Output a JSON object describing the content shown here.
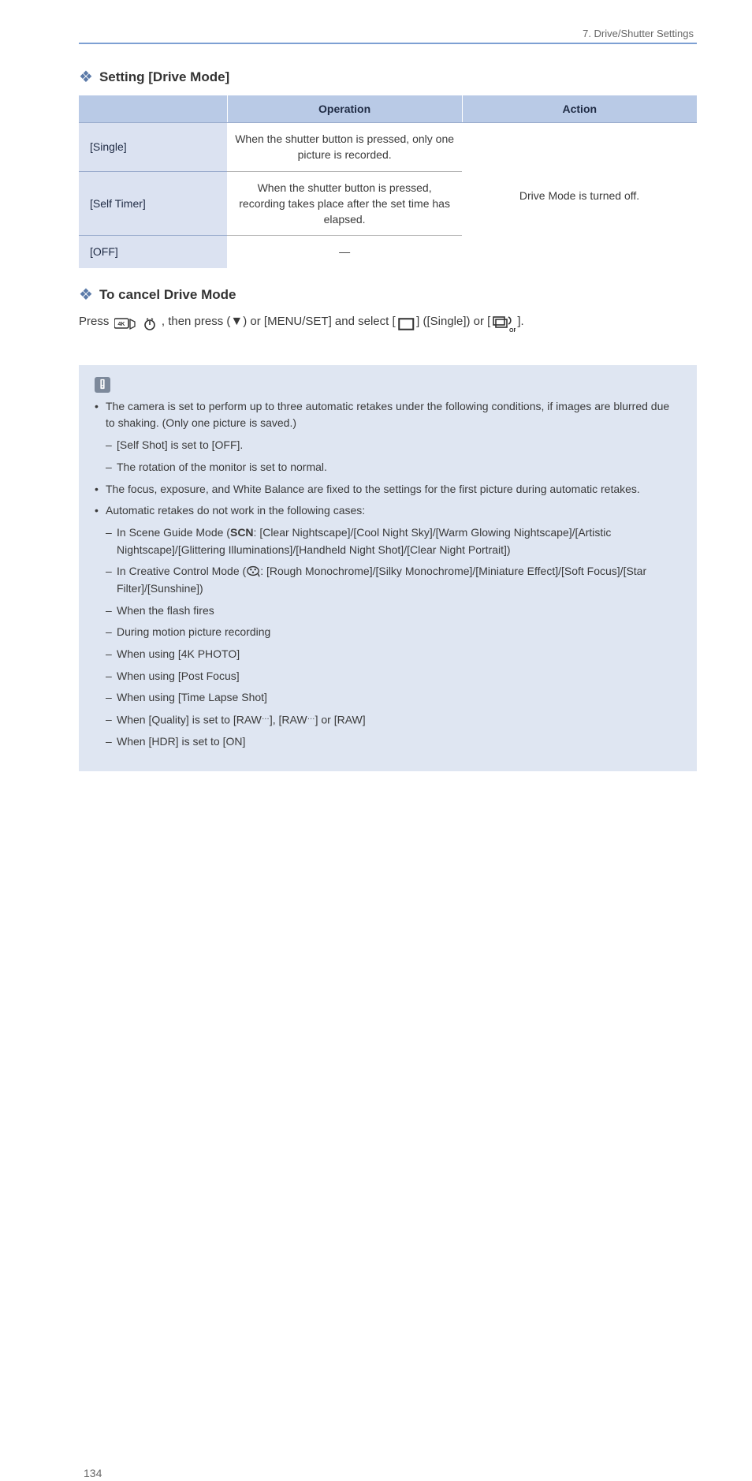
{
  "header": {
    "section_label": "7. Drive/Shutter Settings"
  },
  "sec_setting": {
    "title": "Setting [Drive Mode]",
    "table": {
      "headers": [
        "",
        "Operation",
        "Action"
      ],
      "rows": [
        {
          "label": "[Single]",
          "op": "When the shutter button is pressed, only one picture is recorded.",
          "action_rowspan": "Drive Mode is turned off."
        },
        {
          "label": "[Self Timer]",
          "op": "When the shutter button is pressed, recording takes place after the set time has elapsed."
        },
        {
          "label": "[OFF]",
          "op": "—"
        }
      ]
    }
  },
  "sec_cancel": {
    "title": "To cancel Drive Mode",
    "line_lead": "Press ",
    "line_mid": ", then press ",
    "line_tail1": " or [MENU/SET] and select [",
    "line_tail2": "] ([Single]) or [",
    "line_tail3": "].",
    "icons": {
      "k4": "4K-timer",
      "down": "▼",
      "square": "Single",
      "off": "Drive OFF"
    }
  },
  "notes": {
    "items": [
      "The camera is set to perform up to three automatic retakes under the following conditions, if images are blurred due to shaking. (Only one picture is saved.)",
      "sub:[Self Shot] is set to [OFF].",
      "sub:The rotation of the monitor is set to normal.",
      "The focus, exposure, and White Balance are fixed to the settings for the first picture during automatic retakes.",
      "Automatic retakes do not work in the following cases:",
      "sub:In Scene Guide Mode ([SCN]: [Clear Nightscape]/[Cool Night Sky]/[Warm Glowing Nightscape]/[Artistic Nightscape]/[Glittering Illuminations]/[Handheld Night Shot]/[Clear Night Portrait])",
      "sub:In Creative Control Mode ([creative-control-icon]: [Rough Monochrome]/[Silky Monochrome]/[Miniature Effect]/[Soft Focus]/[Star Filter]/[Sunshine])",
      "sub:When the flash fires",
      "sub:During motion picture recording",
      "sub:When using [4K PHOTO]",
      "sub:When using [Post Focus]",
      "sub:When using [Time Lapse Shot]",
      "sub:When [Quality] is set to [RAW-fine], [RAW-standard] or [RAW]",
      "sub:When [HDR] is set to [ON]"
    ]
  },
  "page_number": "134"
}
